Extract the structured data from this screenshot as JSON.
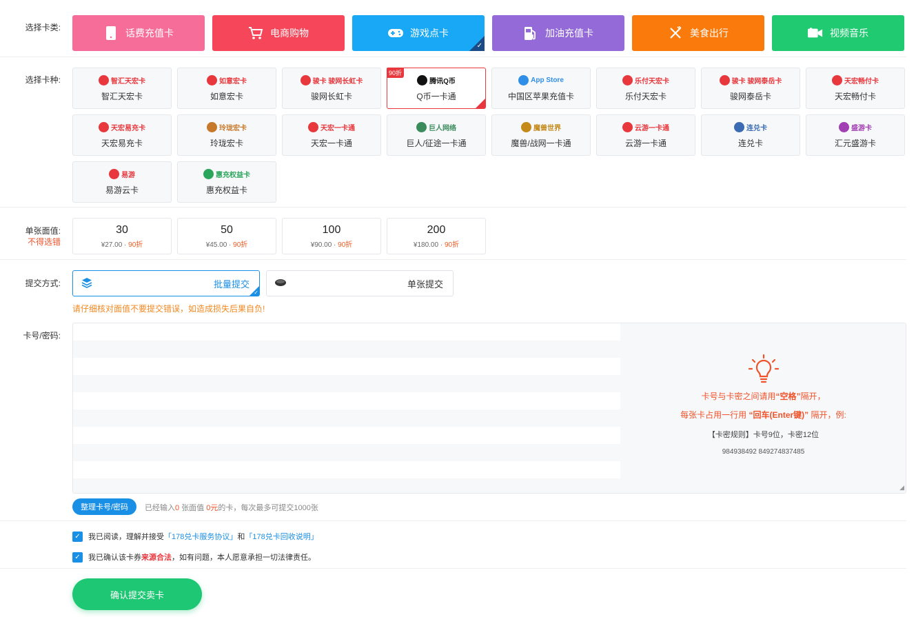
{
  "labels": {
    "category": "选择卡类:",
    "kind": "选择卡种:",
    "face": "单张面值:",
    "face_note": "不得选错",
    "submit_mode": "提交方式:",
    "cards": "卡号/密码:"
  },
  "categories": [
    {
      "label": "话费充值卡",
      "icon": "phone-icon",
      "color": "#f76d9a"
    },
    {
      "label": "电商购物",
      "icon": "cart-icon",
      "color": "#f5465a"
    },
    {
      "label": "游戏点卡",
      "icon": "gamepad-icon",
      "color": "#19a8f5"
    },
    {
      "label": "加油充值卡",
      "icon": "fuel-icon",
      "color": "#9469d8"
    },
    {
      "label": "美食出行",
      "icon": "cutlery-icon",
      "color": "#fb7a0c"
    },
    {
      "label": "视频音乐",
      "icon": "video-icon",
      "color": "#1fca71"
    }
  ],
  "kinds": [
    {
      "logo": "智汇天宏卡",
      "name": "智汇天宏卡",
      "logo_color": "#e8383d"
    },
    {
      "logo": "如意宏卡",
      "name": "如意宏卡",
      "logo_color": "#e8383d"
    },
    {
      "logo": "骏卡 骏网长虹卡",
      "name": "骏网长虹卡",
      "logo_color": "#e8383d"
    },
    {
      "logo": "腾讯Q币",
      "name": "Q币一卡通",
      "logo_color": "#111111",
      "badge": "90折"
    },
    {
      "logo": "App Store",
      "name": "中国区苹果充值卡",
      "logo_color": "#2f8ee6"
    },
    {
      "logo": "乐付天宏卡",
      "name": "乐付天宏卡",
      "logo_color": "#e8383d"
    },
    {
      "logo": "骏卡 骏网泰岳卡",
      "name": "骏网泰岳卡",
      "logo_color": "#e8383d"
    },
    {
      "logo": "天宏畅付卡",
      "name": "天宏畅付卡",
      "logo_color": "#e8383d"
    },
    {
      "logo": "天宏易充卡",
      "name": "天宏易充卡",
      "logo_color": "#e8383d"
    },
    {
      "logo": "玲珑宏卡",
      "name": "玲珑宏卡",
      "logo_color": "#c7792a"
    },
    {
      "logo": "天宏一卡通",
      "name": "天宏一卡通",
      "logo_color": "#e8383d"
    },
    {
      "logo": "巨人网络",
      "name": "巨人/征途一卡通",
      "logo_color": "#3a8c5c"
    },
    {
      "logo": "魔兽世界",
      "name": "魔兽/战网一卡通",
      "logo_color": "#c48a1a"
    },
    {
      "logo": "云游一卡通",
      "name": "云游一卡通",
      "logo_color": "#e8383d"
    },
    {
      "logo": "连兑卡",
      "name": "连兑卡",
      "logo_color": "#3b6cb3"
    },
    {
      "logo": "盛游卡",
      "name": "汇元盛游卡",
      "logo_color": "#a23fb2"
    },
    {
      "logo": "易游",
      "name": "易游云卡",
      "logo_color": "#e8383d"
    },
    {
      "logo": "惠充权益卡",
      "name": "惠充权益卡",
      "logo_color": "#2aa55c"
    }
  ],
  "faces": [
    {
      "value": "30",
      "price": "¥27.00",
      "discount": "90折"
    },
    {
      "value": "50",
      "price": "¥45.00",
      "discount": "90折"
    },
    {
      "value": "100",
      "price": "¥90.00",
      "discount": "90折"
    },
    {
      "value": "200",
      "price": "¥180.00",
      "discount": "90折"
    }
  ],
  "modes": [
    {
      "label": "批量提交",
      "icon": "layers-icon",
      "selected": true
    },
    {
      "label": "单张提交",
      "icon": "card-icon",
      "selected": false
    }
  ],
  "warning": "请仔细核对面值不要提交错误，如造成损失后果自负!",
  "hint": {
    "line1_a": "卡号与卡密之间请用",
    "line1_b": "“空格”",
    "line1_c": "隔开，",
    "line2_a": "每张卡占用一行用",
    "line2_b": "“回车(Enter键)”",
    "line2_c": "隔开，例:",
    "line3": "【卡密规则】卡号9位，卡密12位",
    "line4": "984938492 849274837485"
  },
  "tidy_button": "整理卡号/密码",
  "count": {
    "a": "已经输入",
    "n": "0",
    "b": "张面值",
    "v": "0元",
    "c": "的卡，每次最多可提交1000张"
  },
  "agree1": {
    "a": "我已阅读，理解并接受",
    "link1": "「178兑卡服务协议」",
    "b": "和",
    "link2": "「178兑卡回收说明」"
  },
  "agree2": {
    "a": "我已确认该卡券",
    "b": "来源合法",
    "c": "，如有问题，本人愿意承担一切法律责任。"
  },
  "confirm_button": "确认提交卖卡"
}
